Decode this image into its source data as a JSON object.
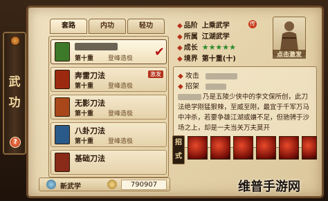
{
  "scroll": {
    "title_top": "武",
    "title_bottom": "功",
    "badge": "?"
  },
  "tabs": [
    {
      "label": "套路",
      "active": true
    },
    {
      "label": "内功",
      "active": false
    },
    {
      "label": "轻功",
      "active": false
    }
  ],
  "skills": [
    {
      "name": "",
      "level": "第十重",
      "tier": "登峰造极",
      "selected": true,
      "equipped": true,
      "book_color": "#3c7a2a"
    },
    {
      "name": "奔雷刀法",
      "level": "第十重",
      "tier": "登峰造极",
      "selected": false,
      "tag": "激发",
      "book_color": "#9c2a10"
    },
    {
      "name": "无影刀法",
      "level": "第十重",
      "tier": "登峰造极",
      "selected": false,
      "book_color": "#a8481a"
    },
    {
      "name": "八卦刀法",
      "level": "第十重",
      "tier": "登峰造极",
      "selected": false,
      "book_color": "#2a5a8a"
    },
    {
      "name": "基础刀法",
      "level": "",
      "tier": "",
      "selected": false,
      "book_color": "#8a2a18"
    }
  ],
  "bottom_bar": {
    "label": "新武学",
    "value": "790907"
  },
  "info": {
    "rank_label": "品阶",
    "rank_value": "上乘武学",
    "rank_seal": "传",
    "faction_label": "所属",
    "faction_value": "江湖武学",
    "growth_label": "成长",
    "growth_stars": "★★★★★",
    "realm_label": "境界",
    "realm_value": "第十重(十)"
  },
  "avatar": {
    "label": "点击激发"
  },
  "stats": {
    "attack_label": "攻击",
    "parry_label": "招架",
    "description": "乃是五陵少侠中的李文保所创，此刀法绝学刚猛狠辣，至威至刚，最宜于千军万马中冲杀，若要争雄江湖或嫌不足，但驰骋于沙场之上，却是一夫当关万夫莫开"
  },
  "moves_label": "招式",
  "watermark": "维普手游网",
  "colors": {
    "accent": "#b3321a",
    "parchment": "#e6d4ad",
    "frame": "#3a2616"
  }
}
